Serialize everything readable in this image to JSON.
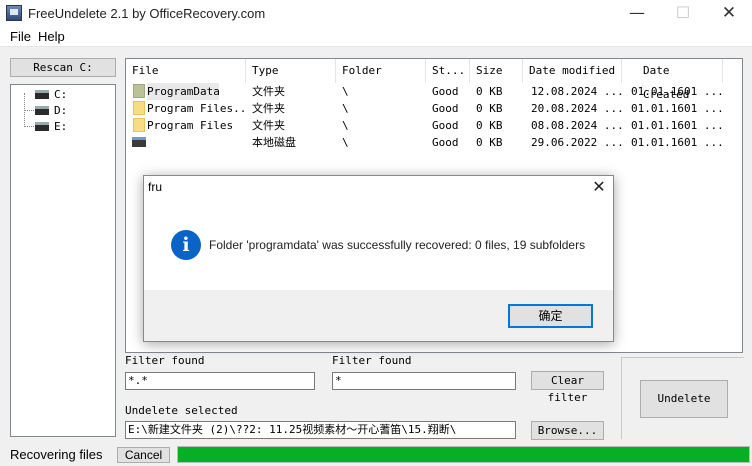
{
  "window": {
    "title": "FreeUndelete 2.1 by OfficeRecovery.com",
    "minimize": "—",
    "maximize": "☐",
    "close": "✕"
  },
  "menu": [
    "File",
    "Help"
  ],
  "left_panel": {
    "rescan_label": "Rescan C:",
    "drives": [
      "C:",
      "D:",
      "E:"
    ]
  },
  "file_list": {
    "columns": [
      "File",
      "Type",
      "Folder",
      "St...",
      "Size",
      "Date modified",
      "Date Created"
    ],
    "rows": [
      {
        "name": "ProgramData",
        "type": "文件夹",
        "folder": "\\",
        "status": "Good",
        "size": "0 KB",
        "modified": "12.08.2024 ...",
        "created": "01.01.1601 ...",
        "icon": "folder-gray"
      },
      {
        "name": "Program Files...",
        "type": "文件夹",
        "folder": "\\",
        "status": "Good",
        "size": "0 KB",
        "modified": "20.08.2024 ...",
        "created": "01.01.1601 ...",
        "icon": "folder"
      },
      {
        "name": "Program Files",
        "type": "文件夹",
        "folder": "\\",
        "status": "Good",
        "size": "0 KB",
        "modified": "08.08.2024 ...",
        "created": "01.01.1601 ...",
        "icon": "folder"
      },
      {
        "name": "",
        "type": "本地磁盘",
        "folder": "\\",
        "status": "Good",
        "size": "0 KB",
        "modified": "29.06.2022 ...",
        "created": "01.01.1601 ...",
        "icon": "drive"
      }
    ]
  },
  "filters": {
    "label_1": "Filter found",
    "value_1": "*.*",
    "label_2": "Filter found",
    "value_2": "*",
    "clear_label": "Clear filter"
  },
  "undelete": {
    "label": "Undelete selected",
    "path": "E:\\新建文件夹 (2)\\??2: 11.25视频素材～开心蓍笛\\15.翔断\\",
    "browse_label": "Browse...",
    "button_label": "Undelete"
  },
  "status": {
    "text": "Recovering files",
    "cancel_label": "Cancel",
    "progress": 1.0,
    "progress_color": "#06b025"
  },
  "dialog": {
    "title": "fru",
    "icon_glyph": "i",
    "message": "Folder 'programdata' was successfully recovered: 0 files, 19 subfolders",
    "ok_label": "确定",
    "close": "✕"
  }
}
